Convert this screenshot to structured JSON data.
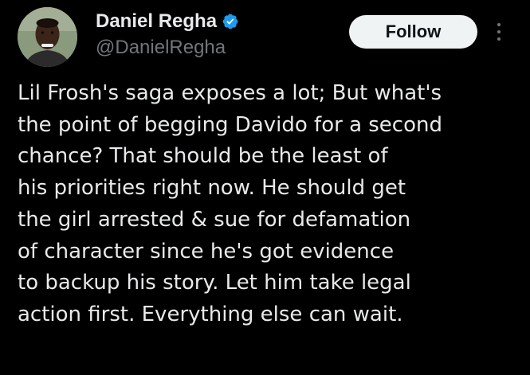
{
  "author": {
    "display_name": "Daniel Regha",
    "handle": "@DanielRegha",
    "verified": true,
    "avatar_icon": "profile-photo"
  },
  "actions": {
    "follow_label": "Follow",
    "more_icon": "more-vertical-icon"
  },
  "tweet": {
    "lines": [
      "Lil Frosh's saga exposes a lot; But what's",
      "the point of begging Davido for a second",
      "chance? That should be the least of",
      "his priorities right now. He should get",
      "the girl arrested & sue for defamation",
      "of character since he's got evidence",
      "to backup his story. Let him take legal",
      "action first. Everything else can wait."
    ]
  },
  "colors": {
    "background": "#000000",
    "text_primary": "#e7e9ea",
    "text_secondary": "#71767b",
    "verified_blue": "#1d9bf0",
    "follow_bg": "#eff3f4",
    "follow_text": "#0f1419"
  }
}
